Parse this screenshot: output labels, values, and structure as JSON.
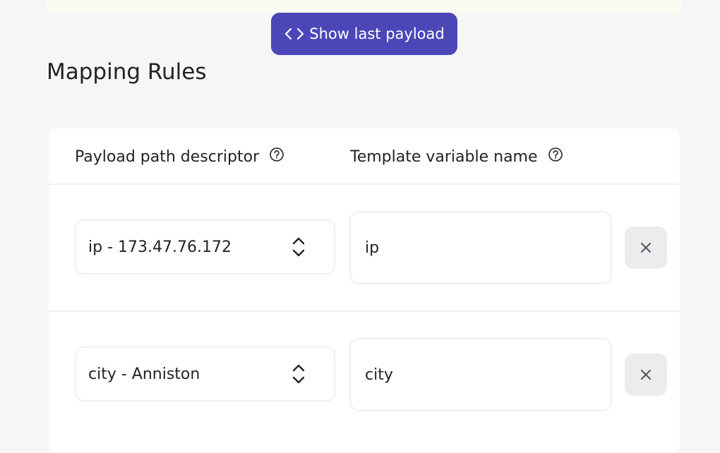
{
  "payload_button": {
    "label": "Show last payload",
    "icon": "code-icon"
  },
  "section": {
    "title": "Mapping Rules"
  },
  "table": {
    "columns": [
      {
        "label": "Payload path descriptor",
        "icon": "help-circle-icon"
      },
      {
        "label": "Template variable name",
        "icon": "help-circle-icon"
      }
    ],
    "rows": [
      {
        "path": "ip - 173.47.76.172",
        "variable": "ip",
        "remove_icon": "close-icon"
      },
      {
        "path": "city - Anniston",
        "variable": "city",
        "remove_icon": "close-icon"
      }
    ]
  },
  "colors": {
    "accent": "#4b47b8",
    "background": "#f6f6f7",
    "card": "#ffffff",
    "remove_button": "#ececee"
  }
}
